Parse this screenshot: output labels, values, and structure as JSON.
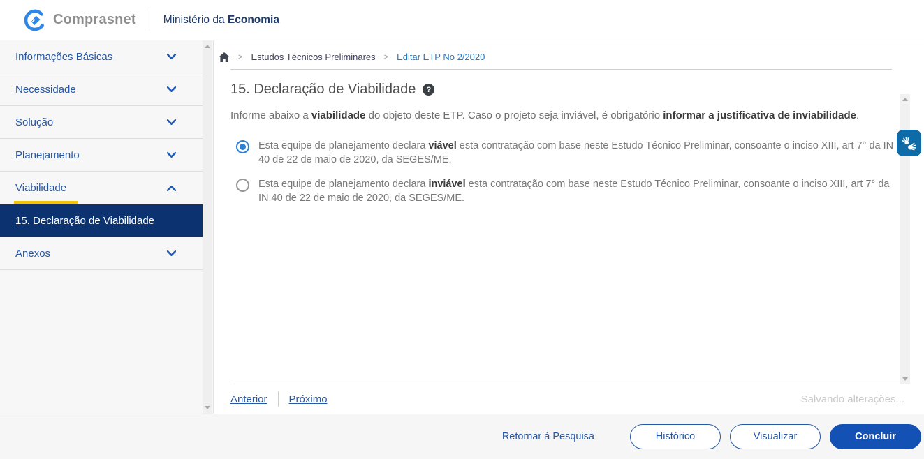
{
  "header": {
    "brand": "Comprasnet",
    "ministry_prefix": "Ministério da ",
    "ministry_bold": "Economia"
  },
  "breadcrumb": {
    "separator": ">",
    "items": [
      "Estudos Técnicos Preliminares",
      "Editar ETP No 2/2020"
    ]
  },
  "sidebar": {
    "sections": [
      {
        "label": "Informações Básicas",
        "state": "collapsed"
      },
      {
        "label": "Necessidade",
        "state": "collapsed"
      },
      {
        "label": "Solução",
        "state": "collapsed"
      },
      {
        "label": "Planejamento",
        "state": "collapsed"
      },
      {
        "label": "Viabilidade",
        "state": "expanded"
      },
      {
        "label": "Anexos",
        "state": "collapsed"
      }
    ],
    "active_item": "15. Declaração de Viabilidade"
  },
  "main": {
    "title": "15. Declaração de Viabilidade",
    "help_icon": "?",
    "intro_segments": [
      {
        "t": "Informe abaixo a ",
        "b": false
      },
      {
        "t": "viabilidade",
        "b": true
      },
      {
        "t": " do objeto deste ETP. Caso o projeto seja inviável, é obrigatório ",
        "b": false
      },
      {
        "t": "informar a justificativa de inviabilidade",
        "b": true
      },
      {
        "t": ".",
        "b": false
      }
    ],
    "options": [
      {
        "selected": true,
        "segments": [
          {
            "t": "Esta equipe de planejamento declara ",
            "b": false
          },
          {
            "t": "viável",
            "b": true
          },
          {
            "t": " esta contratação com base neste Estudo Técnico Preliminar, consoante o inciso XIII, art 7° da IN 40 de 22 de maio de 2020, da SEGES/ME.",
            "b": false
          }
        ]
      },
      {
        "selected": false,
        "segments": [
          {
            "t": "Esta equipe de planejamento declara ",
            "b": false
          },
          {
            "t": "inviável",
            "b": true
          },
          {
            "t": " esta contratação com base neste Estudo Técnico Preliminar, consoante o inciso XIII, art 7° da IN 40 de 22 de maio de 2020, da SEGES/ME.",
            "b": false
          }
        ]
      }
    ],
    "nav": {
      "previous": "Anterior",
      "next": "Próximo",
      "status": "Salvando alterações..."
    }
  },
  "footer": {
    "return_link": "Retornar à Pesquisa",
    "history_button": "Histórico",
    "preview_button": "Visualizar",
    "conclude_button": "Concluir"
  },
  "colors": {
    "accent_blue": "#1351b4",
    "link_blue": "#2658a5",
    "breadcrumb_active_blue": "#2678c3",
    "active_item_bg": "#0c326f",
    "highlight_yellow": "#f5c400",
    "radio_selected_blue": "#2d7fd3",
    "vlibras_blue": "#0e6ba8"
  }
}
